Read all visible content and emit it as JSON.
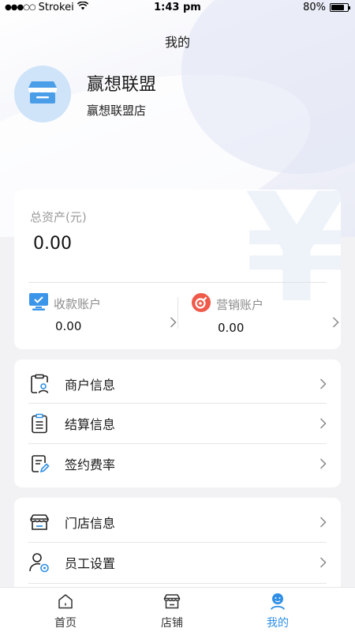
{
  "status_bar": {
    "carrier": "Strokei",
    "signal_dots": "●●●○○",
    "time": "1:43 pm",
    "battery": "80%",
    "battery_level": 0.8
  },
  "page_title": "我的",
  "profile": {
    "name": "赢想联盟",
    "store_name": "赢想联盟店"
  },
  "assets": {
    "label": "总资产(元)",
    "value": "0.00",
    "watermark": "¥",
    "collection_account": {
      "label": "收款账户",
      "value": "0.00"
    },
    "marketing_account": {
      "label": "营销账户",
      "value": "0.00"
    }
  },
  "merchant_menu": [
    {
      "label": "商户信息",
      "icon": "merchant-info-icon"
    },
    {
      "label": "结算信息",
      "icon": "settlement-icon"
    },
    {
      "label": "签约费率",
      "icon": "contract-icon"
    }
  ],
  "store_menu": [
    {
      "label": "门店信息",
      "icon": "store-icon"
    },
    {
      "label": "员工设置",
      "icon": "staff-settings-icon"
    }
  ],
  "tabbar": {
    "active": "mine",
    "tabs": [
      {
        "label": "首页",
        "icon": "home-icon"
      },
      {
        "label": "店铺",
        "icon": "shop-icon"
      },
      {
        "label": "我的",
        "icon": "user-icon"
      }
    ]
  },
  "colors": {
    "accent": "#2f8fe6",
    "avatar_bg": "#cfe3f9",
    "marketing_icon": "#ef5a4a"
  }
}
